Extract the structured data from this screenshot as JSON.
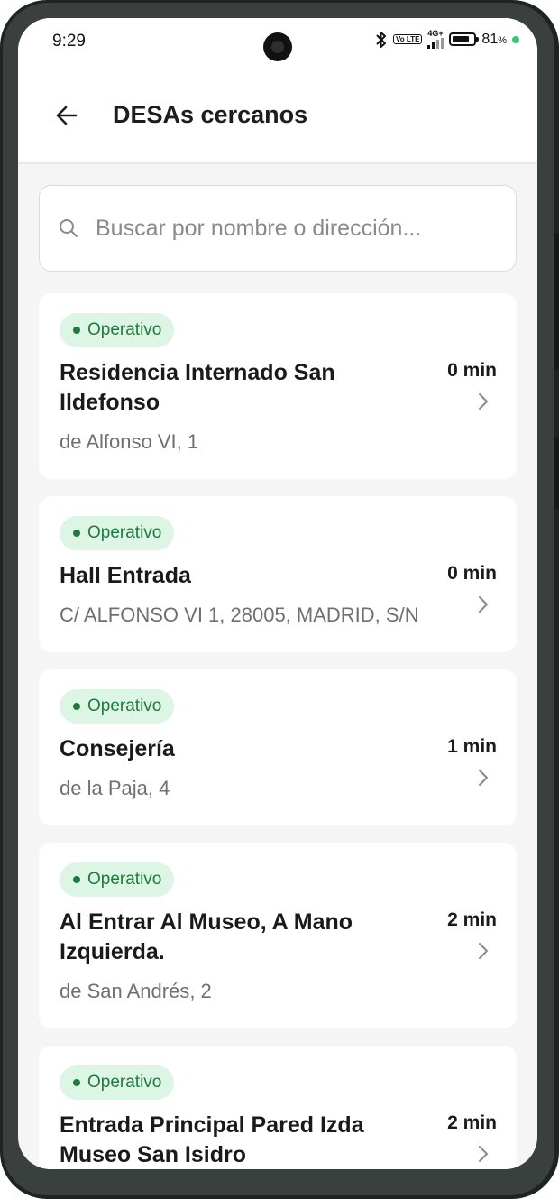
{
  "status_bar": {
    "time": "9:29",
    "volte": "Vo LTE",
    "network": "4G+",
    "battery_percent_value": "81",
    "battery_percent_sign": "%"
  },
  "header": {
    "title": "DESAs cercanos"
  },
  "search": {
    "placeholder": "Buscar por nombre o dirección...",
    "value": ""
  },
  "items": [
    {
      "status": "Operativo",
      "name": "Residencia Internado San Ildefonso",
      "address": "de Alfonso VI, 1",
      "time": "0 min"
    },
    {
      "status": "Operativo",
      "name": "Hall Entrada",
      "address": "C/ ALFONSO VI 1, 28005, MADRID, S/N",
      "time": "0 min"
    },
    {
      "status": "Operativo",
      "name": "Consejería",
      "address": "de la Paja, 4",
      "time": "1 min"
    },
    {
      "status": "Operativo",
      "name": "Al Entrar Al Museo, A Mano Izquierda.",
      "address": "de San Andrés, 2",
      "time": "2 min"
    },
    {
      "status": "Operativo",
      "name": "Entrada Principal Pared Izda Museo San Isidro",
      "address": "",
      "time": "2 min"
    }
  ],
  "colors": {
    "status_green": "#1f7a3d",
    "status_badge_bg": "#dcf5e4",
    "background": "#f5f5f5"
  },
  "icons": [
    "back-arrow-icon",
    "search-icon",
    "chevron-right-icon",
    "bluetooth-icon",
    "signal-icon",
    "battery-icon"
  ]
}
